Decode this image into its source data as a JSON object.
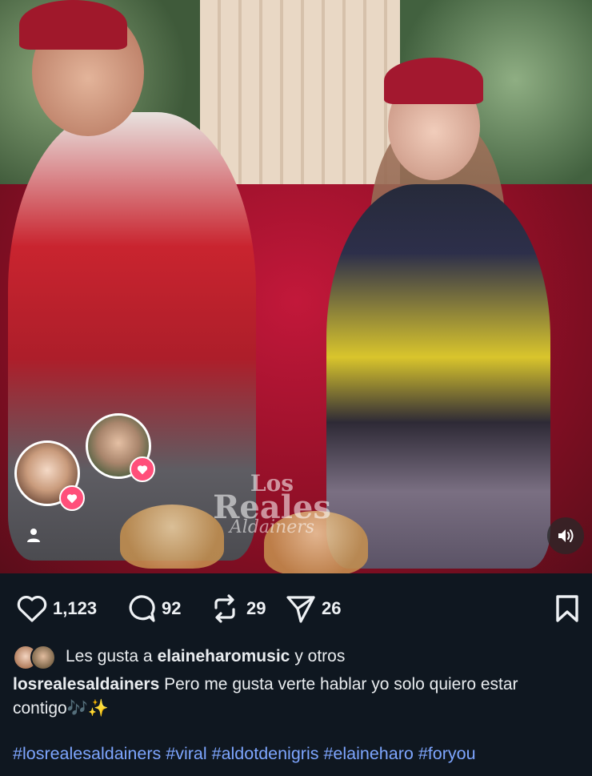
{
  "video": {
    "watermark": {
      "line1": "Los",
      "line2": "Reales",
      "line3": "Aldainers"
    }
  },
  "actions": {
    "likes": "1,123",
    "comments": "92",
    "reposts": "29",
    "shares": "26"
  },
  "liked_by": {
    "prefix": "Les gusta a",
    "user": "elaineharomusic",
    "suffix": "y otros"
  },
  "caption": {
    "username": "losrealesaldainers",
    "text": "Pero me gusta verte hablar yo solo quiero estar contigo🎶✨"
  },
  "hashtags": [
    "#losrealesaldainers",
    "#viral",
    "#aldotdenigris",
    "#elaineharo",
    "#foryou"
  ],
  "colors": {
    "background": "#0f1720",
    "hashtag": "#7ea6ff",
    "heart_badge": "#ff4f7a"
  },
  "icons": [
    "heart-icon",
    "comment-icon",
    "repost-icon",
    "share-icon",
    "bookmark-icon",
    "sound-icon",
    "person-icon"
  ]
}
